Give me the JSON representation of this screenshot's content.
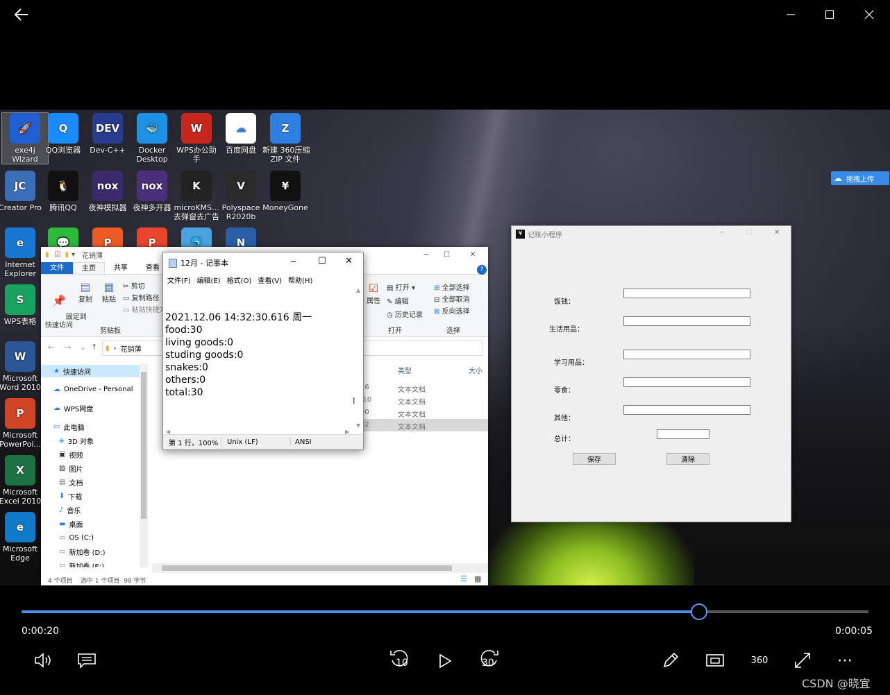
{
  "player": {
    "current_time": "0:00:20",
    "remaining_time": "0:00:05",
    "progress": 0.8,
    "skip_back_label": "10",
    "skip_forward_label": "30",
    "vr_label": "360",
    "watermark": "CSDN @晓宜"
  },
  "desktop": {
    "icons": [
      {
        "label": "exe4j\nWizard",
        "color": "#1f5fd1",
        "glyph": "🚀"
      },
      {
        "label": "QQ浏览器",
        "color": "#1a8cff",
        "glyph": "Q"
      },
      {
        "label": "Dev-C++",
        "color": "#2a3c8f",
        "glyph": "DEV"
      },
      {
        "label": "Docker\nDesktop",
        "color": "#1d91e6",
        "glyph": "🐳"
      },
      {
        "label": "WPS办公助\n手",
        "color": "#c8271e",
        "glyph": "W"
      },
      {
        "label": "百度网盘",
        "color": "#ffffff",
        "glyph": "☁"
      },
      {
        "label": "新建 360压缩\nZIP 文件",
        "color": "#2f7fe0",
        "glyph": "Z"
      },
      {
        "label": "Creator Pro",
        "color": "#3a6fb8",
        "glyph": "JC"
      },
      {
        "label": "腾讯QQ",
        "color": "#111111",
        "glyph": "🐧"
      },
      {
        "label": "夜神模拟器",
        "color": "#3b2a6b",
        "glyph": "nox"
      },
      {
        "label": "夜神多开器",
        "color": "#4a2f7a",
        "glyph": "nox"
      },
      {
        "label": "microKMS...\n去弹窗去广告",
        "color": "#222222",
        "glyph": "K"
      },
      {
        "label": "Polyspace\nR2020b",
        "color": "#2a2a2a",
        "glyph": "V"
      },
      {
        "label": "MoneyGone",
        "color": "#111111",
        "glyph": "¥"
      },
      {
        "label": "Internet\nExplorer",
        "color": "#1777d1",
        "glyph": "e"
      },
      {
        "label": "",
        "color": "#2dbb3a",
        "glyph": "💬"
      },
      {
        "label": "",
        "color": "#ee5a24",
        "glyph": "P"
      },
      {
        "label": "",
        "color": "#e8452c",
        "glyph": "P"
      },
      {
        "label": "",
        "color": "#4aa3e0",
        "glyph": "🐬"
      },
      {
        "label": "",
        "color": "#2a5fa8",
        "glyph": "N"
      },
      {
        "label": "WPS表格",
        "color": "#1aa260",
        "glyph": "S"
      },
      {
        "label": "Microsoft\nWord 2010",
        "color": "#2b5797",
        "glyph": "W"
      },
      {
        "label": "Microsoft\nPowerPoi...",
        "color": "#d04525",
        "glyph": "P"
      },
      {
        "label": "Microsoft\nExcel 2010",
        "color": "#1e7145",
        "glyph": "X"
      },
      {
        "label": "Microsoft\nEdge",
        "color": "#0f7bc8",
        "glyph": "e"
      }
    ],
    "upload_badge": "拖拽上传"
  },
  "explorer": {
    "title": "花销薄",
    "tabs": [
      "文件",
      "主页",
      "共享",
      "查看"
    ],
    "ribbon": {
      "pin": "固定到\n快速访问",
      "copy": "复制",
      "paste": "粘贴",
      "cut": "剪切",
      "copy_path": "复制路径",
      "paste_shortcut": "粘贴快捷方",
      "clipboard_group": "剪贴板",
      "properties": "属性",
      "open": "打开 ▾",
      "edit": "编辑",
      "history": "历史记录",
      "open_group": "打开",
      "select_all": "全部选择",
      "select_none": "全部取消",
      "invert": "反向选择",
      "select_group": "选择"
    },
    "breadcrumb": "花销薄",
    "nav": [
      {
        "label": "快速访问",
        "icon": "star-icon",
        "sel": true
      },
      {
        "label": "OneDrive - Personal",
        "icon": "cloud-icon"
      },
      {
        "label": "WPS网盘",
        "icon": "cloud-icon"
      },
      {
        "label": "此电脑",
        "icon": "pc-icon"
      },
      {
        "label": "3D 对象",
        "icon": "cube-icon"
      },
      {
        "label": "视频",
        "icon": "video-icon"
      },
      {
        "label": "图片",
        "icon": "picture-icon"
      },
      {
        "label": "文档",
        "icon": "document-icon"
      },
      {
        "label": "下载",
        "icon": "download-icon"
      },
      {
        "label": "音乐",
        "icon": "music-icon"
      },
      {
        "label": "桌面",
        "icon": "desktop-icon"
      },
      {
        "label": "OS (C:)",
        "icon": "drive-icon"
      },
      {
        "label": "新加卷 (D:)",
        "icon": "drive-icon"
      },
      {
        "label": "新加卷 (E:)",
        "icon": "drive-icon"
      }
    ],
    "columns": {
      "type": "类型",
      "size": "大小"
    },
    "rows": [
      {
        "time": "46",
        "type": "文本文档"
      },
      {
        "time": ":10",
        "type": "文本文档"
      },
      {
        "time": "00",
        "type": "文本文档"
      },
      {
        "time": "32",
        "type": "文本文档",
        "sel": true
      }
    ],
    "status": "4 个项目    选中 1 个项目  98 字节"
  },
  "notepad": {
    "title": "12月 - 记事本",
    "menu": [
      "文件(F)",
      "编辑(E)",
      "格式(O)",
      "查看(V)",
      "帮助(H)"
    ],
    "lines": [
      "2021.12.06 14:32:30.616 周一",
      "food:30",
      "living goods:0",
      "studing goods:0",
      "snakes:0",
      "others:0",
      "total:30"
    ],
    "status": {
      "position": "第 1 行，100%",
      "eol": "Unix (LF)",
      "encoding": "ANSI"
    }
  },
  "accounting": {
    "title": "记账小程序",
    "fields": [
      {
        "label": "饭钱："
      },
      {
        "label": "生活用品："
      },
      {
        "label": "学习用品："
      },
      {
        "label": "零食："
      },
      {
        "label": "其他："
      }
    ],
    "total_label": "总计：",
    "save_label": "保存",
    "clear_label": "清除"
  }
}
